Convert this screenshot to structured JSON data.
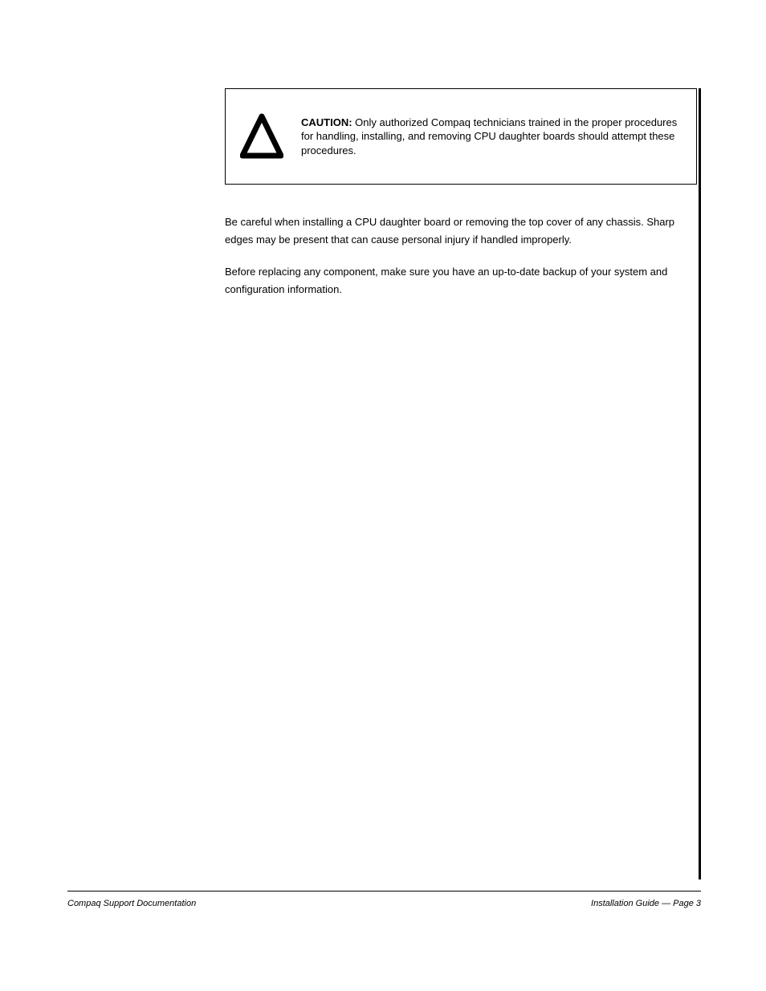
{
  "caution": {
    "lead": "CAUTION:",
    "text": "Only authorized Compaq technicians trained in the proper procedures for handling, installing, and removing CPU daughter boards should attempt these procedures."
  },
  "body": {
    "p1": "Be careful when installing a CPU daughter board or removing the top cover of any chassis. Sharp edges may be present that can cause personal injury if handled improperly.",
    "p2": "Before replacing any component, make sure you have an up-to-date backup of your system and configuration information."
  },
  "footer": {
    "left": "Compaq Support Documentation",
    "right": "Installation Guide — Page 3"
  }
}
